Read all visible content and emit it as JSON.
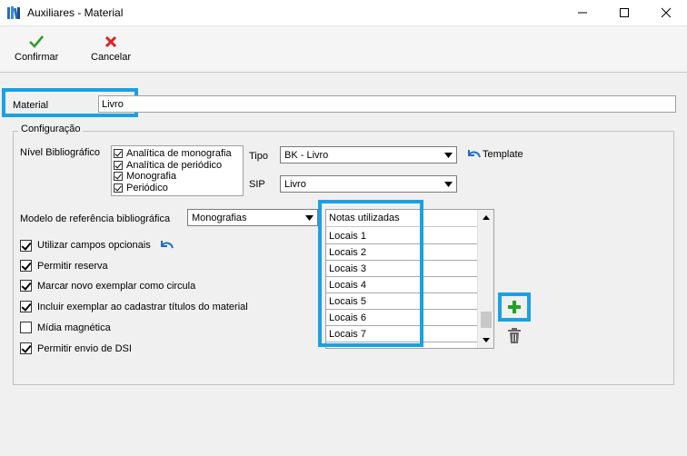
{
  "window": {
    "title": "Auxiliares - Material"
  },
  "toolbar": {
    "confirm_label": "Confirmar",
    "cancel_label": "Cancelar"
  },
  "material": {
    "label": "Material",
    "value": "Livro"
  },
  "config": {
    "legend": "Configuração",
    "nivel_label": "Nível Bibliográfico",
    "nivel_items": [
      {
        "label": "Analítica de monografia",
        "checked": true
      },
      {
        "label": "Analítica de periódico",
        "checked": true
      },
      {
        "label": "Monografia",
        "checked": true
      },
      {
        "label": "Periódico",
        "checked": true
      }
    ],
    "tipo_label": "Tipo",
    "tipo_value": "BK - Livro",
    "template_label": "Template",
    "sip_label": "SIP",
    "sip_value": "Livro",
    "modelo_label": "Modelo de referência bibliográfica",
    "modelo_value": "Monografias",
    "checkboxes": [
      {
        "label": "Utilizar campos opcionais",
        "checked": true
      },
      {
        "label": "Permitir reserva",
        "checked": true
      },
      {
        "label": "Marcar novo exemplar como circula",
        "checked": true
      },
      {
        "label": "Incluir exemplar ao cadastrar títulos do material",
        "checked": true
      },
      {
        "label": "Mídia magnética",
        "checked": false
      },
      {
        "label": "Permitir envio de DSI",
        "checked": true
      }
    ],
    "notes": {
      "header": "Notas utilizadas",
      "items": [
        "Locais 1",
        "Locais 2",
        "Locais 3",
        "Locais 4",
        "Locais 5",
        "Locais 6",
        "Locais 7"
      ]
    }
  },
  "colors": {
    "highlight": "#1ba1e2",
    "confirm": "#2e9e2e",
    "cancel": "#e02020",
    "add": "#22a022"
  }
}
